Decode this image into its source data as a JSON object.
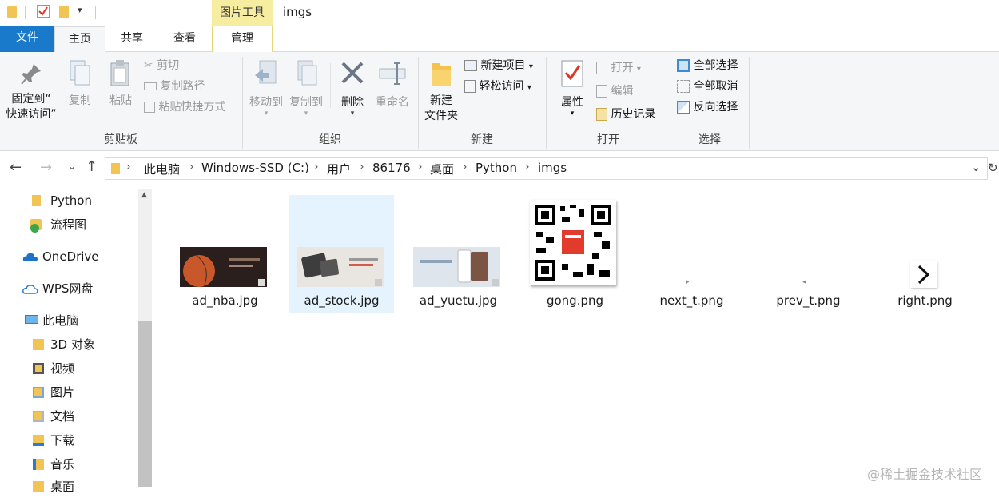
{
  "window": {
    "title": "imgs",
    "contextual_tab_group": "图片工具"
  },
  "ribbon_tabs": {
    "file": "文件",
    "home": "主页",
    "share": "共享",
    "view": "查看",
    "manage": "管理"
  },
  "ribbon": {
    "clipboard": {
      "label": "剪贴板",
      "pin_line1": "固定到“",
      "pin_line2": "快速访问”",
      "copy": "复制",
      "paste": "粘贴",
      "cut": "剪切",
      "copy_path": "复制路径",
      "paste_shortcut": "粘贴快捷方式"
    },
    "organize": {
      "label": "组织",
      "move_to": "移动到",
      "copy_to": "复制到",
      "delete": "删除",
      "rename": "重命名"
    },
    "new": {
      "label": "新建",
      "new_folder_line1": "新建",
      "new_folder_line2": "文件夹",
      "new_item": "新建项目",
      "easy_access": "轻松访问"
    },
    "open": {
      "label": "打开",
      "properties": "属性",
      "open": "打开",
      "edit": "编辑",
      "history": "历史记录"
    },
    "select": {
      "label": "选择",
      "select_all": "全部选择",
      "select_none": "全部取消",
      "invert": "反向选择"
    }
  },
  "address": {
    "crumbs": [
      "此电脑",
      "Windows-SSD (C:)",
      "用户",
      "86176",
      "桌面",
      "Python",
      "imgs"
    ]
  },
  "nav": {
    "items": [
      "Python",
      "流程图",
      "OneDrive",
      "WPS网盘",
      "此电脑",
      "3D 对象",
      "视频",
      "图片",
      "文档",
      "下载",
      "音乐",
      "桌面"
    ]
  },
  "files": [
    "ad_nba.jpg",
    "ad_stock.jpg",
    "ad_yuetu.jpg",
    "gong.png",
    "next_t.png",
    "prev_t.png",
    "right.png"
  ],
  "watermark": "@稀土掘金技术社区",
  "colors": {
    "accent": "#1979ca",
    "selected": "#e5f3ff",
    "contextual": "#f6eda0"
  }
}
